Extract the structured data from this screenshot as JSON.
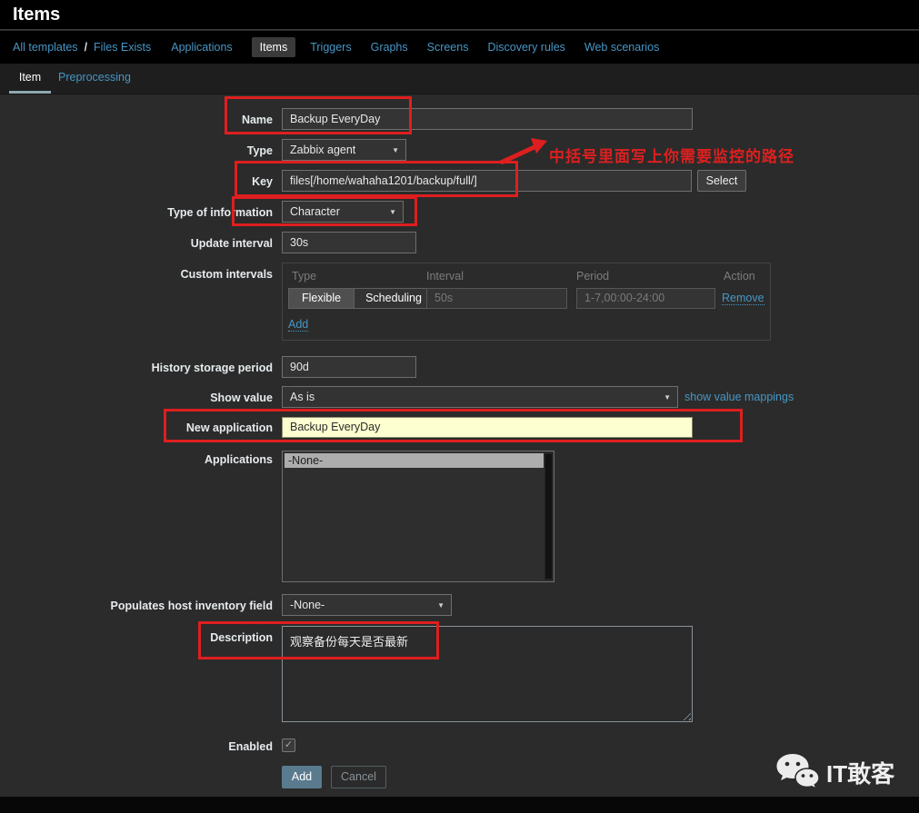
{
  "header": {
    "title": "Items"
  },
  "breadcrumb": {
    "all_templates": "All templates",
    "separator": "/",
    "template_name": "Files Exists"
  },
  "nav": {
    "items": [
      {
        "label": "Applications",
        "selected": false
      },
      {
        "label": "Items",
        "selected": true
      },
      {
        "label": "Triggers",
        "selected": false
      },
      {
        "label": "Graphs",
        "selected": false
      },
      {
        "label": "Screens",
        "selected": false
      },
      {
        "label": "Discovery rules",
        "selected": false
      },
      {
        "label": "Web scenarios",
        "selected": false
      }
    ]
  },
  "tabs": {
    "item": "Item",
    "preprocessing": "Preprocessing"
  },
  "form": {
    "name": {
      "label": "Name",
      "value": "Backup EveryDay"
    },
    "type": {
      "label": "Type",
      "value": "Zabbix agent"
    },
    "key": {
      "label": "Key",
      "value": "files[/home/wahaha1201/backup/full/]",
      "button": "Select"
    },
    "type_of_information": {
      "label": "Type of information",
      "value": "Character"
    },
    "update_interval": {
      "label": "Update interval",
      "value": "30s"
    },
    "custom_intervals": {
      "label": "Custom intervals",
      "headers": [
        "Type",
        "Interval",
        "Period",
        "Action"
      ],
      "row": {
        "flexible": "Flexible",
        "scheduling": "Scheduling",
        "interval": "50s",
        "period": "1-7,00:00-24:00",
        "remove": "Remove"
      },
      "add": "Add"
    },
    "history_storage_period": {
      "label": "History storage period",
      "value": "90d"
    },
    "show_value": {
      "label": "Show value",
      "value": "As is",
      "link": "show value mappings"
    },
    "new_application": {
      "label": "New application",
      "value": "Backup EveryDay"
    },
    "applications": {
      "label": "Applications",
      "selected_option": "-None-"
    },
    "populates_host_inventory_field": {
      "label": "Populates host inventory field",
      "value": "-None-"
    },
    "description": {
      "label": "Description",
      "value": "观察备份每天是否最新"
    },
    "enabled": {
      "label": "Enabled",
      "checked": true
    },
    "buttons": {
      "add": "Add",
      "cancel": "Cancel"
    }
  },
  "annotation": {
    "text": "中括号里面写上你需要监控的路径",
    "color": "#de1f1f"
  },
  "watermark": {
    "text": "IT敢客"
  },
  "icons": {
    "dropdown": "▼",
    "check": "✓"
  },
  "colors": {
    "link_blue": "#4796c4",
    "annotation_red": "#de1f1f",
    "highlight_yellow": "#fdffd0",
    "page_bg": "#2b2b2b",
    "chrome_bg": "#000000"
  }
}
